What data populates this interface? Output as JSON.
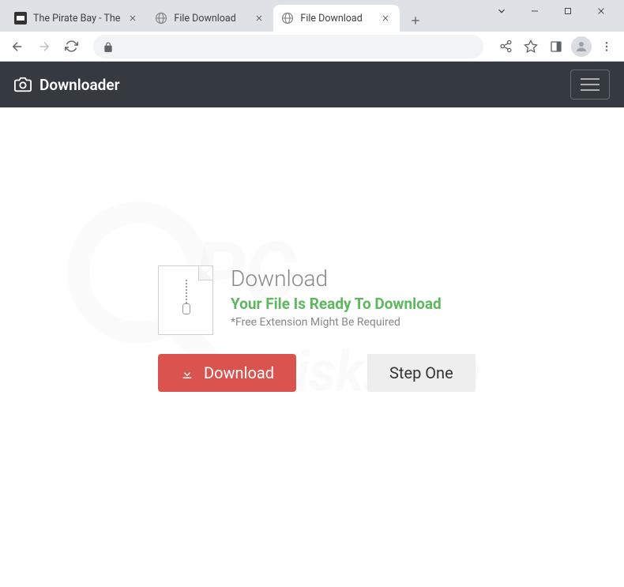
{
  "window": {
    "tabs": [
      {
        "title": "The Pirate Bay - The",
        "active": false,
        "favicon": "custom"
      },
      {
        "title": "File Download",
        "active": false,
        "favicon": "globe"
      },
      {
        "title": "File Download",
        "active": true,
        "favicon": "globe"
      }
    ]
  },
  "header": {
    "brand": "Downloader"
  },
  "content": {
    "heading": "Download",
    "ready_text": "Your File Is Ready To Download",
    "note": "*Free Extension Might Be Required",
    "download_button": "Download",
    "step_button": "Step One"
  },
  "watermark": {
    "main": "PC",
    "sub": "risk.com"
  }
}
